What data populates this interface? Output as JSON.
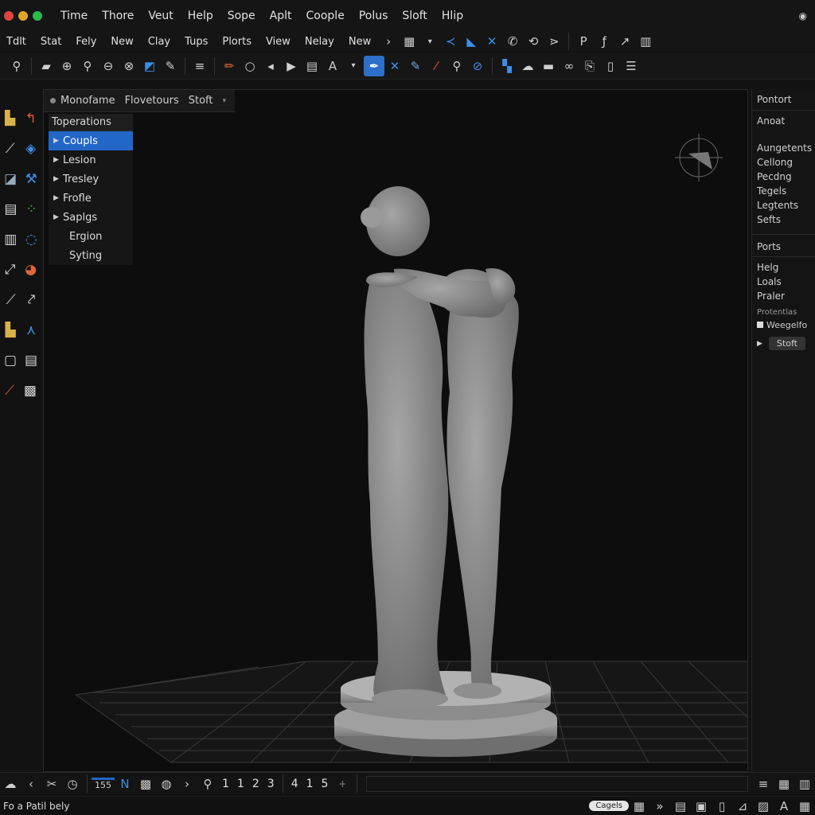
{
  "titlebar": {
    "menus": [
      "Time",
      "Thore",
      "Veut",
      "Help",
      "Sope",
      "Aplt",
      "Coople",
      "Polus",
      "Sloft",
      "Hlip"
    ],
    "traffic_colors": [
      "#e0443e",
      "#e0a526",
      "#2fb84c"
    ]
  },
  "menubar": {
    "items": [
      "Tdlt",
      "Stat",
      "Fely",
      "New",
      "Clay",
      "Tups",
      "Plorts",
      "View",
      "Nelay",
      "New"
    ]
  },
  "toolbar": {
    "active_icon": "pen-icon"
  },
  "viewport": {
    "tabs": [
      "Monofame",
      "Flovetours",
      "Stoft"
    ],
    "tree_header": "Toperations",
    "tree_items": [
      {
        "label": "Coupls",
        "expandable": true,
        "selected": true
      },
      {
        "label": "Lesion",
        "expandable": true,
        "selected": false
      },
      {
        "label": "Tresley",
        "expandable": true,
        "selected": false
      },
      {
        "label": "Frofle",
        "expandable": true,
        "selected": false
      },
      {
        "label": "Saplgs",
        "expandable": true,
        "selected": false
      },
      {
        "label": "Ergion",
        "expandable": false,
        "selected": false
      },
      {
        "label": "Syting",
        "expandable": false,
        "selected": false
      }
    ]
  },
  "rightpanel": {
    "header1": "Pontort",
    "sub1": "Anoat",
    "group1": [
      "Aungetents",
      "Cellong",
      "Pecdng",
      "Tegels",
      "Legtents",
      "Sefts"
    ],
    "header2": "Ports",
    "group2": [
      "Helg",
      "Loals",
      "Praler"
    ],
    "small_label": "Protentlas",
    "checkbox_label": "Weegelfo",
    "button_label": "Stoft"
  },
  "timeline": {
    "zoom": "155",
    "pages": [
      "1",
      "1",
      "2",
      "3",
      "4",
      "1",
      "5"
    ]
  },
  "statusbar": {
    "text": "Fo a Patil bely",
    "pill": "Cagels"
  },
  "colors": {
    "accent": "#2266c8"
  }
}
